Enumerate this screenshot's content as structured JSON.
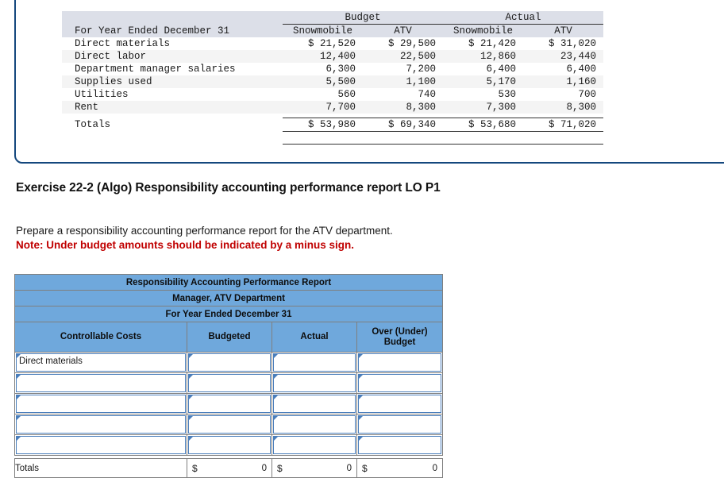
{
  "reference_panel": {
    "group_headers": [
      {
        "label": "Budget",
        "span": 2
      },
      {
        "label": "Actual",
        "span": 2
      }
    ],
    "column_headers": {
      "row_label": "For Year Ended December 31",
      "budget_snowmobile": "Snowmobile",
      "budget_atv": "ATV",
      "actual_snowmobile": "Snowmobile",
      "actual_atv": "ATV"
    },
    "rows": [
      {
        "label": "Direct materials",
        "budget_snowmobile": "$ 21,520",
        "budget_atv": "$ 29,500",
        "actual_snowmobile": "$ 21,420",
        "actual_atv": "$ 31,020"
      },
      {
        "label": "Direct labor",
        "budget_snowmobile": "12,400",
        "budget_atv": "22,500",
        "actual_snowmobile": "12,860",
        "actual_atv": "23,440"
      },
      {
        "label": "Department manager salaries",
        "budget_snowmobile": "6,300",
        "budget_atv": "7,200",
        "actual_snowmobile": "6,400",
        "actual_atv": "6,400"
      },
      {
        "label": "Supplies used",
        "budget_snowmobile": "5,500",
        "budget_atv": "1,100",
        "actual_snowmobile": "5,170",
        "actual_atv": "1,160"
      },
      {
        "label": "Utilities",
        "budget_snowmobile": "560",
        "budget_atv": "740",
        "actual_snowmobile": "530",
        "actual_atv": "700"
      },
      {
        "label": "Rent",
        "budget_snowmobile": "7,700",
        "budget_atv": "8,300",
        "actual_snowmobile": "7,300",
        "actual_atv": "8,300"
      }
    ],
    "totals": {
      "label": "Totals",
      "budget_snowmobile": "$ 53,980",
      "budget_atv": "$ 69,340",
      "actual_snowmobile": "$ 53,680",
      "actual_atv": "$ 71,020"
    }
  },
  "exercise": {
    "title": "Exercise 22-2 (Algo) Responsibility accounting performance report LO P1",
    "instruction": "Prepare a responsibility accounting performance report for the ATV department.",
    "note": "Note: Under budget amounts should be indicated by a minus sign.",
    "note_color": "#C00000"
  },
  "answer_form": {
    "title_lines": [
      "Responsibility Accounting Performance Report",
      "Manager, ATV Department",
      "For Year Ended December 31"
    ],
    "column_headers": {
      "controllable_costs": "Controllable Costs",
      "budgeted": "Budgeted",
      "actual": "Actual",
      "over_under": "Over (Under) Budget"
    },
    "header_bg": "#6FA8DC",
    "input_rows": [
      {
        "label": "Direct materials",
        "budgeted": "",
        "actual": "",
        "over_under": ""
      },
      {
        "label": "",
        "budgeted": "",
        "actual": "",
        "over_under": ""
      },
      {
        "label": "",
        "budgeted": "",
        "actual": "",
        "over_under": ""
      },
      {
        "label": "",
        "budgeted": "",
        "actual": "",
        "over_under": ""
      },
      {
        "label": "",
        "budgeted": "",
        "actual": "",
        "over_under": ""
      }
    ],
    "totals_row": {
      "label": "Totals",
      "budgeted_symbol": "$",
      "budgeted_value": "0",
      "actual_symbol": "$",
      "actual_value": "0",
      "over_under_symbol": "$",
      "over_under_value": "0"
    }
  }
}
